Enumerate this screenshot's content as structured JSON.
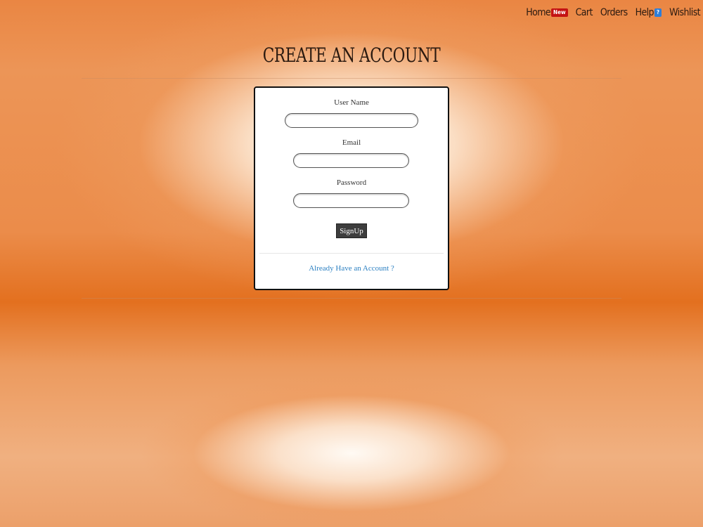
{
  "nav": {
    "items": [
      {
        "label": "Home",
        "badge": "New"
      },
      {
        "label": "Cart"
      },
      {
        "label": "Orders"
      },
      {
        "label": "Help",
        "badge": "?"
      },
      {
        "label": "Wishlist"
      }
    ]
  },
  "page": {
    "title": "CREATE AN ACCOUNT"
  },
  "form": {
    "username": {
      "label": "User Name",
      "value": "",
      "placeholder": ""
    },
    "email": {
      "label": "Email",
      "value": "",
      "placeholder": ""
    },
    "password": {
      "label": "Password",
      "value": "",
      "placeholder": ""
    },
    "submit_label": "SignUp",
    "login_link": "Already Have an Account ?"
  },
  "colors": {
    "accent_orange": "#e8782f",
    "new_badge": "#c41313",
    "help_badge": "#2e7ed8",
    "link": "#2a7fc1",
    "button": "#3d3d3d"
  }
}
